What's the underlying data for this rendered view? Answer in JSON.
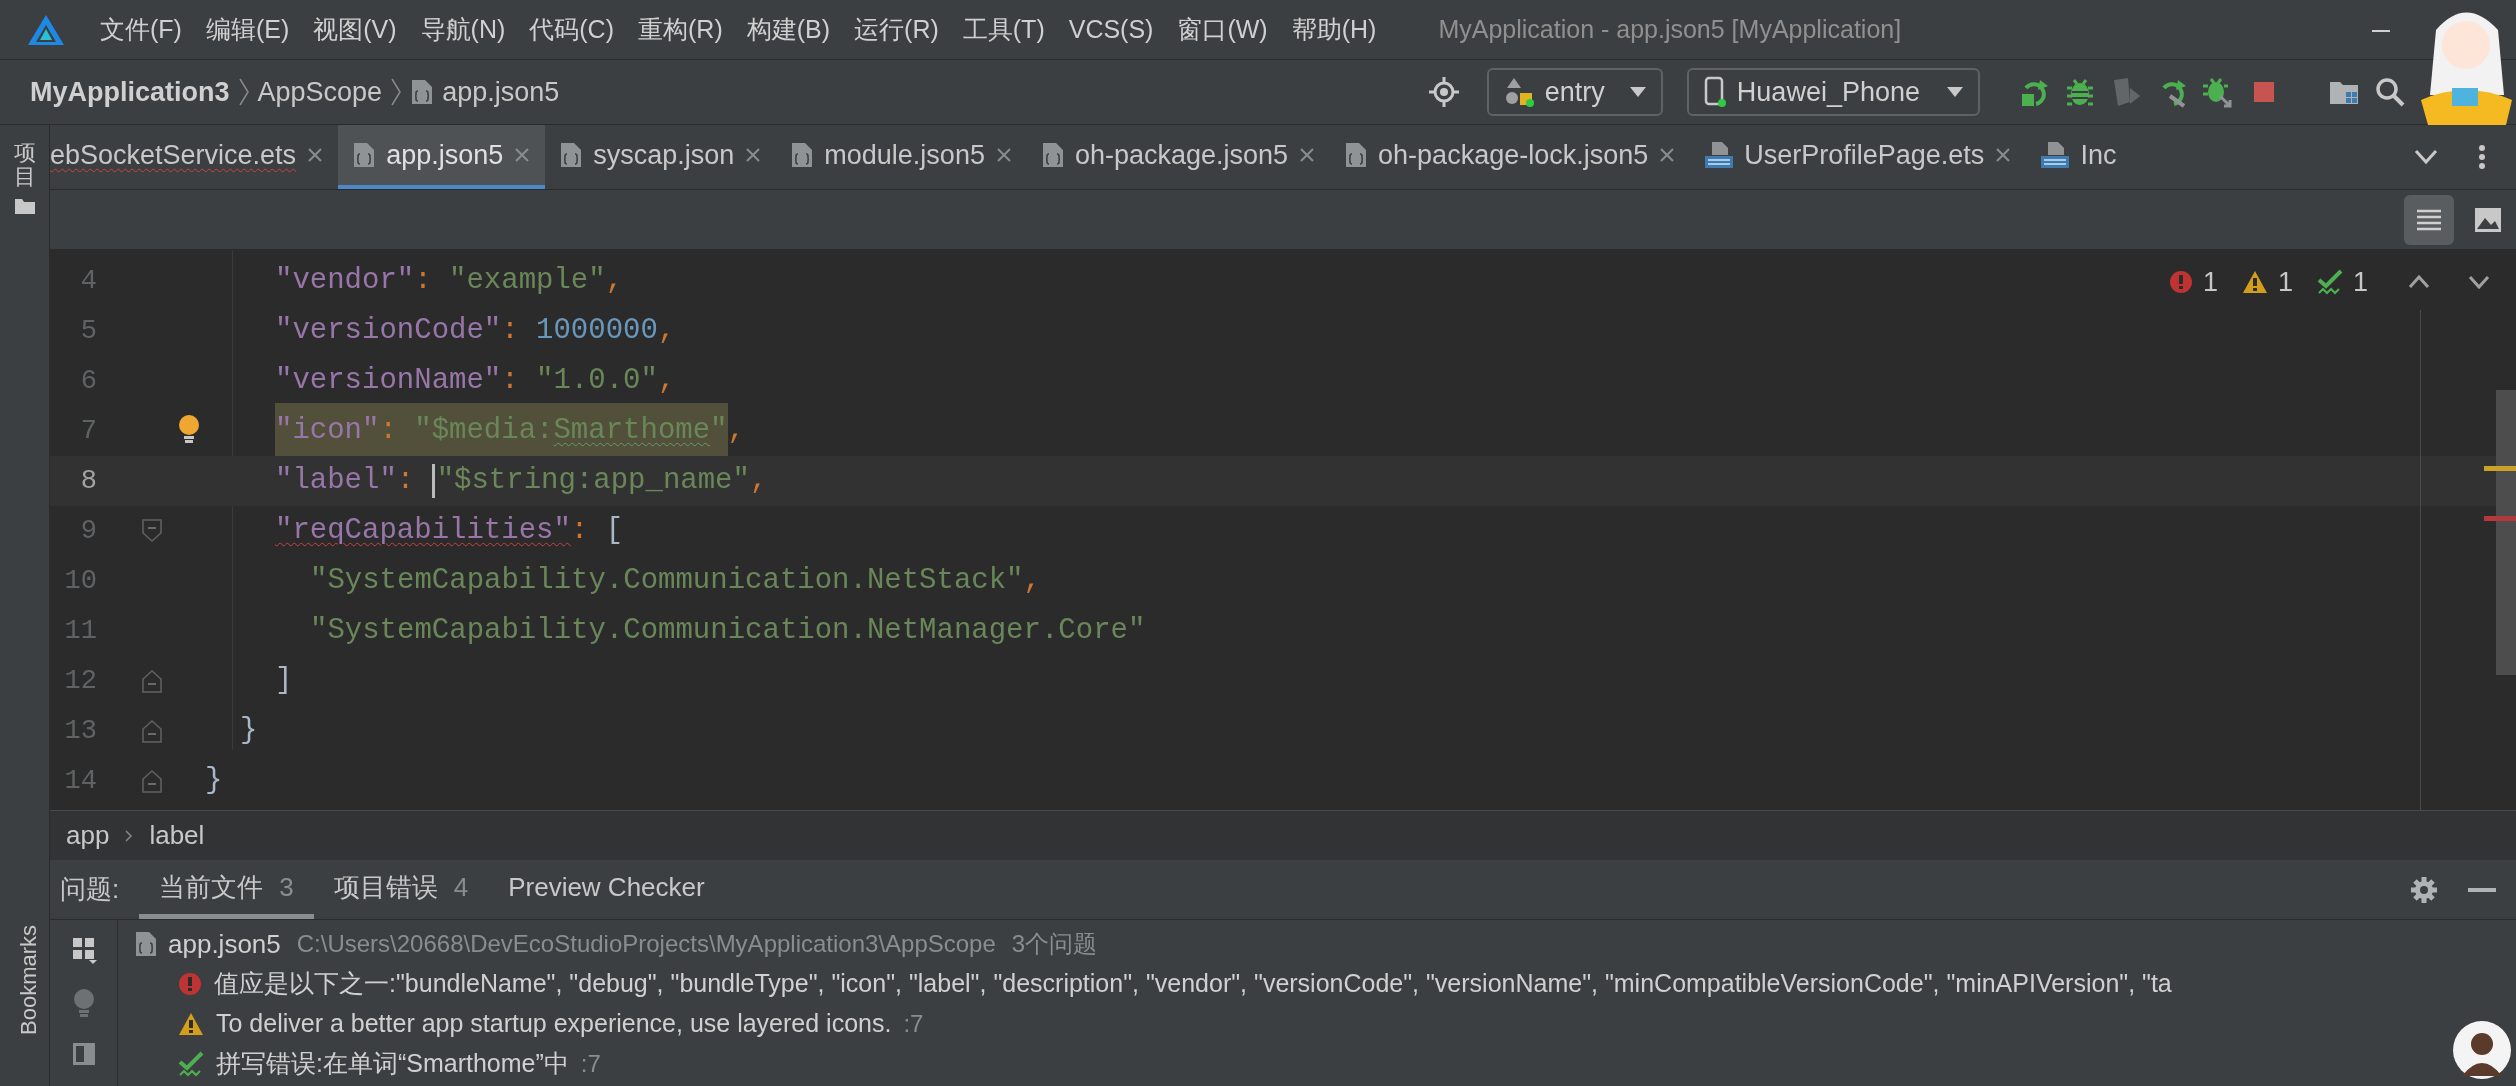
{
  "window": {
    "title": "MyApplication - app.json5 [MyApplication]"
  },
  "menu": [
    "文件(F)",
    "编辑(E)",
    "视图(V)",
    "导航(N)",
    "代码(C)",
    "重构(R)",
    "构建(B)",
    "运行(R)",
    "工具(T)",
    "VCS(S)",
    "窗口(W)",
    "帮助(H)"
  ],
  "breadcrumb": [
    {
      "label": "MyApplication3",
      "kind": "project"
    },
    {
      "label": "AppScope",
      "kind": "folder"
    },
    {
      "label": "app.json5",
      "kind": "file"
    }
  ],
  "run_config": {
    "module": "entry",
    "device": "Huawei_Phone"
  },
  "toolbar": [
    {
      "kind": "run",
      "disabled": false
    },
    {
      "kind": "debug",
      "disabled": false
    },
    {
      "kind": "attach",
      "disabled": true
    },
    {
      "kind": "rerun",
      "disabled": false
    },
    {
      "kind": "debug_rerun",
      "disabled": false
    },
    {
      "kind": "stop",
      "disabled": false
    },
    {
      "kind": "structure",
      "disabled": false
    },
    {
      "kind": "search",
      "disabled": false
    }
  ],
  "side_tabs": [
    {
      "label": "项目"
    },
    {
      "label": "Bookmarks"
    }
  ],
  "tabs": [
    {
      "label": "ebSocketService.ets",
      "kind": "plain",
      "selected": false,
      "error": true,
      "closable": true
    },
    {
      "label": "app.json5",
      "kind": "json",
      "selected": true,
      "error": false,
      "closable": true
    },
    {
      "label": "syscap.json",
      "kind": "json",
      "selected": false,
      "error": false,
      "closable": true
    },
    {
      "label": "module.json5",
      "kind": "json",
      "selected": false,
      "error": false,
      "closable": true
    },
    {
      "label": "oh-package.json5",
      "kind": "json",
      "selected": false,
      "error": false,
      "closable": true
    },
    {
      "label": "oh-package-lock.json5",
      "kind": "json",
      "selected": false,
      "error": false,
      "closable": true
    },
    {
      "label": "UserProfilePage.ets",
      "kind": "ets",
      "selected": false,
      "error": false,
      "closable": true
    },
    {
      "label": "Inc",
      "kind": "ets",
      "selected": false,
      "error": false,
      "closable": false
    }
  ],
  "inspections": [
    {
      "kind": "error",
      "count": "1"
    },
    {
      "kind": "warning",
      "count": "1"
    },
    {
      "kind": "typo",
      "count": "1"
    }
  ],
  "code": [
    {
      "kind": "group",
      "children": [
        {
          "kind": "group",
          "children": [
            {
              "number": "4",
              "kind": "plain",
              "current": false,
              "tokens": [
                {
                  "kind": "key",
                  "text": "\"vendor\""
                },
                {
                  "kind": "punct",
                  "text": ": "
                },
                {
                  "kind": "string",
                  "text": "\"example\""
                },
                {
                  "kind": "punct",
                  "text": ","
                }
              ]
            },
            {
              "number": "5",
              "kind": "plain",
              "current": false,
              "tokens": [
                {
                  "kind": "key",
                  "text": "\"versionCode\""
                },
                {
                  "kind": "punct",
                  "text": ": "
                },
                {
                  "kind": "number",
                  "text": "1000000"
                },
                {
                  "kind": "punct",
                  "text": ","
                }
              ]
            },
            {
              "number": "6",
              "kind": "plain",
              "current": false,
              "tokens": [
                {
                  "kind": "key",
                  "text": "\"versionName\""
                },
                {
                  "kind": "punct",
                  "text": ": "
                },
                {
                  "kind": "string",
                  "text": "\"1.0.0\""
                },
                {
                  "kind": "punct",
                  "text": ","
                }
              ]
            },
            {
              "number": "7",
              "kind": "bulb",
              "current": false,
              "tokens": [
                {
                  "kind": "key",
                  "text": "\"icon\"",
                  "highlight": true
                },
                {
                  "kind": "punct",
                  "text": ": ",
                  "highlight": true
                },
                {
                  "kind": "string",
                  "text": "\"$media:",
                  "highlight": true
                },
                {
                  "kind": "string",
                  "text": "Smarthome",
                  "highlight": true,
                  "misspelled": true
                },
                {
                  "kind": "string",
                  "text": "\"",
                  "highlight": true
                },
                {
                  "kind": "punct",
                  "text": ","
                }
              ]
            },
            {
              "number": "8",
              "kind": "plain",
              "current": true,
              "tokens": [
                {
                  "kind": "key",
                  "text": "\"label\""
                },
                {
                  "kind": "punct",
                  "text": ": "
                },
                {
                  "kind": "string",
                  "text": "\"$string:app_name\"",
                  "caret": true
                },
                {
                  "kind": "punct",
                  "text": ","
                }
              ]
            },
            {
              "number": "9",
              "kind": "fold_start",
              "current": false,
              "tokens": [
                {
                  "kind": "key",
                  "text": "\"reqCapabilities\"",
                  "invalid": true
                },
                {
                  "kind": "punct",
                  "text": ": "
                },
                {
                  "kind": "bracket",
                  "text": "["
                }
              ],
              "children": [
                {
                  "number": "10",
                  "kind": "plain",
                  "current": false,
                  "tokens": [
                    {
                      "kind": "string",
                      "text": "\"SystemCapability.Communication.NetStack\""
                    },
                    {
                      "kind": "punct",
                      "text": ","
                    }
                  ]
                },
                {
                  "number": "11",
                  "kind": "plain",
                  "current": false,
                  "tokens": [
                    {
                      "kind": "string",
                      "text": "\"SystemCapability.Communication.NetManager.Core\""
                    }
                  ]
                }
              ]
            },
            {
              "number": "12",
              "kind": "fold_end",
              "current": false,
              "tokens": [
                {
                  "kind": "bracket",
                  "text": "]"
                }
              ]
            }
          ]
        },
        {
          "number": "13",
          "kind": "fold_end",
          "current": false,
          "tokens": [
            {
              "kind": "bracket",
              "text": "}"
            }
          ]
        }
      ]
    },
    {
      "number": "14",
      "kind": "fold_end",
      "current": false,
      "tokens": [
        {
          "kind": "bracket",
          "text": "}"
        }
      ]
    }
  ],
  "scroll_marks": [
    {
      "color": "#c9a227"
    },
    {
      "color": "#b33a3a"
    }
  ],
  "path_bar": [
    "app",
    "label"
  ],
  "problems": {
    "title": "问题:",
    "tabs": [
      {
        "label": "当前文件",
        "count": "3",
        "selected": true
      },
      {
        "label": "项目错误",
        "count": "4",
        "selected": false
      },
      {
        "label": "Preview Checker",
        "selected": false
      }
    ],
    "file": {
      "name": "app.json5",
      "path": "C:\\Users\\20668\\DevEcoStudioProjects\\MyApplication3\\AppScope",
      "count": "3个问题"
    },
    "items": [
      {
        "kind": "error",
        "text": "值应是以下之一:\"bundleName\", \"debug\", \"bundleType\", \"icon\", \"label\", \"description\", \"vendor\", \"versionCode\", \"versionName\", \"minCompatibleVersionCode\", \"minAPIVersion\", \"ta"
      },
      {
        "kind": "warning",
        "text": "To deliver a better app startup experience, use layered icons.",
        "line": ":7"
      },
      {
        "kind": "typo",
        "text": "拼写错误:在单词“Smarthome”中",
        "line": ":7"
      }
    ]
  }
}
